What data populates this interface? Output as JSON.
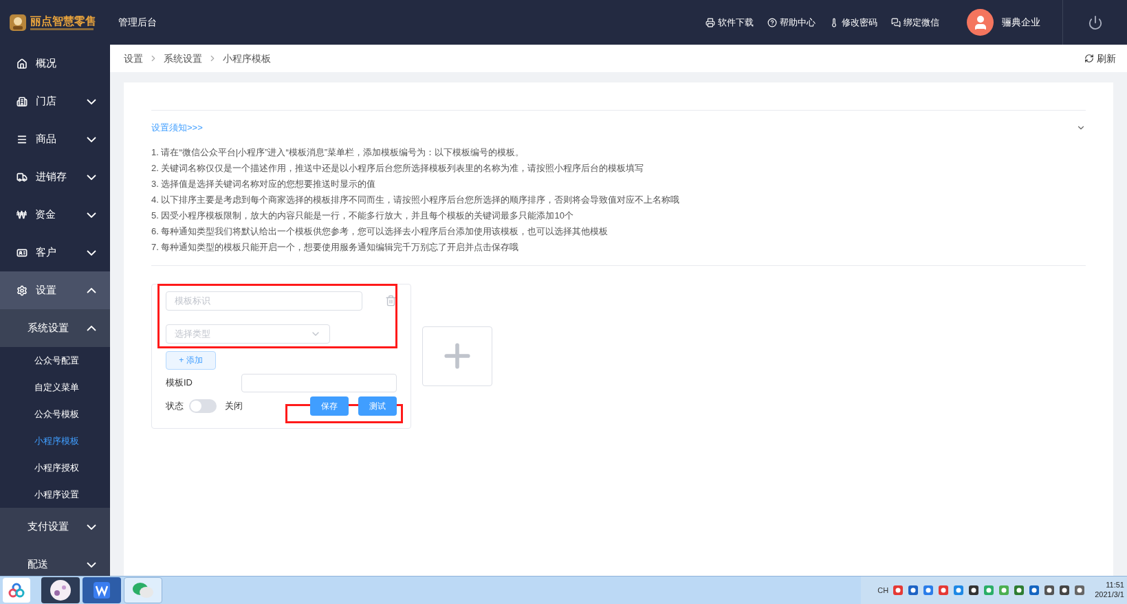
{
  "header": {
    "logo_text": "丽点智慧零售",
    "title": "管理后台",
    "links": [
      {
        "kind": "download",
        "label": "软件下载"
      },
      {
        "kind": "help",
        "label": "帮助中心"
      },
      {
        "kind": "password",
        "label": "修改密码"
      },
      {
        "kind": "wechat",
        "label": "绑定微信"
      }
    ],
    "user": {
      "name": "骊典企业"
    }
  },
  "sidebar": {
    "items": [
      {
        "kind": "home",
        "label": "概况",
        "expanded": false,
        "selected": false
      },
      {
        "kind": "store",
        "label": "门店",
        "expanded": false,
        "selected": false
      },
      {
        "kind": "goods",
        "label": "商品",
        "expanded": false,
        "selected": false
      },
      {
        "kind": "stock",
        "label": "进销存",
        "expanded": false,
        "selected": false
      },
      {
        "kind": "money",
        "label": "资金",
        "expanded": false,
        "selected": false
      },
      {
        "kind": "customer",
        "label": "客户",
        "expanded": false,
        "selected": false
      },
      {
        "kind": "settings",
        "label": "设置",
        "expanded": true,
        "selected": false,
        "children": [
          {
            "label": "系统设置",
            "expanded": true,
            "selected": false,
            "children": [
              {
                "label": "公众号配置",
                "selected": false
              },
              {
                "label": "自定义菜单",
                "selected": false
              },
              {
                "label": "公众号模板",
                "selected": false
              },
              {
                "label": "小程序模板",
                "selected": true
              },
              {
                "label": "小程序授权",
                "selected": false
              },
              {
                "label": "小程序设置",
                "selected": false
              }
            ]
          },
          {
            "label": "支付设置",
            "expanded": false,
            "selected": false
          },
          {
            "label": "配送",
            "expanded": false,
            "selected": false
          }
        ]
      }
    ]
  },
  "breadcrumb": [
    "设置",
    "系统设置",
    "小程序模板"
  ],
  "refresh_label": "刷新",
  "notice": {
    "title": "设置须知>>>",
    "expanded": true,
    "lines": [
      "1. 请在“微信公众平台|小程序”进入“模板消息”菜单栏，添加模板编号为：以下模板编号的模板。",
      "2. 关键词名称仅仅是一个描述作用，推送中还是以小程序后台您所选择模板列表里的名称为准，请按照小程序后台的模板填写",
      "3. 选择值是选择关键词名称对应的您想要推送时显示的值",
      "4. 以下排序主要是考虑到每个商家选择的模板排序不同而生，请按照小程序后台您所选择的顺序排序，否则将会导致值对应不上名称哦",
      "5. 因受小程序模板限制，放大的内容只能是一行，不能多行放大，并且每个模板的关键词最多只能添加10个",
      "6. 每种通知类型我们将默认给出一个模板供您参考，您可以选择去小程序后台添加使用该模板，也可以选择其他模板",
      "7. 每种通知类型的模板只能开启一个，想要使用服务通知编辑完千万别忘了开启并点击保存哦"
    ]
  },
  "template_form": {
    "id_placeholder": "模板标识",
    "type_placeholder": "选择类型",
    "add_button": "+ 添加",
    "template_id_label": "模板ID",
    "status_label": "状态",
    "status": {
      "on": false,
      "label": "关闭"
    },
    "save_button": "保存",
    "test_button": "测试",
    "highlight_fields": true,
    "highlight_buttons": true
  },
  "taskbar": {
    "language": "CH",
    "time": "11:51",
    "date": "2021/3/1"
  }
}
